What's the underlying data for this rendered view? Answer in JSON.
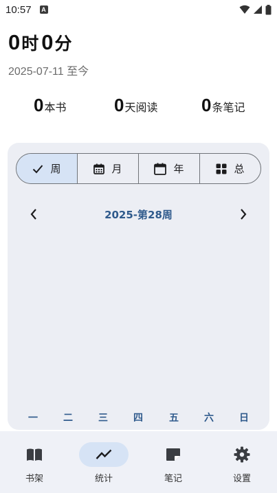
{
  "status": {
    "time": "10:57",
    "notice_letter": "A"
  },
  "header": {
    "hours": "0",
    "hours_unit": "时",
    "minutes": "0",
    "minutes_unit": "分",
    "date_range": "2025-07-11 至今"
  },
  "stats": [
    {
      "value": "0",
      "label": "本书"
    },
    {
      "value": "0",
      "label": "天阅读"
    },
    {
      "value": "0",
      "label": "条笔记"
    }
  ],
  "range_tabs": [
    {
      "label": "周",
      "icon": "check-icon",
      "selected": true
    },
    {
      "label": "月",
      "icon": "calendar-month-icon",
      "selected": false
    },
    {
      "label": "年",
      "icon": "calendar-icon",
      "selected": false
    },
    {
      "label": "总",
      "icon": "grid-icon",
      "selected": false
    }
  ],
  "period_label": "2025-第28周",
  "weekdays": [
    "一",
    "二",
    "三",
    "四",
    "五",
    "六",
    "日"
  ],
  "bottom_nav": [
    {
      "label": "书架",
      "icon": "book-icon",
      "active": false
    },
    {
      "label": "统计",
      "icon": "trend-icon",
      "active": true
    },
    {
      "label": "笔记",
      "icon": "note-icon",
      "active": false
    },
    {
      "label": "设置",
      "icon": "gear-icon",
      "active": false
    }
  ],
  "colors": {
    "accent": "#2f5a8c",
    "selected_bg": "#d6e3f5",
    "card_bg": "#eceef4",
    "nav_bg": "#eff1f7"
  }
}
